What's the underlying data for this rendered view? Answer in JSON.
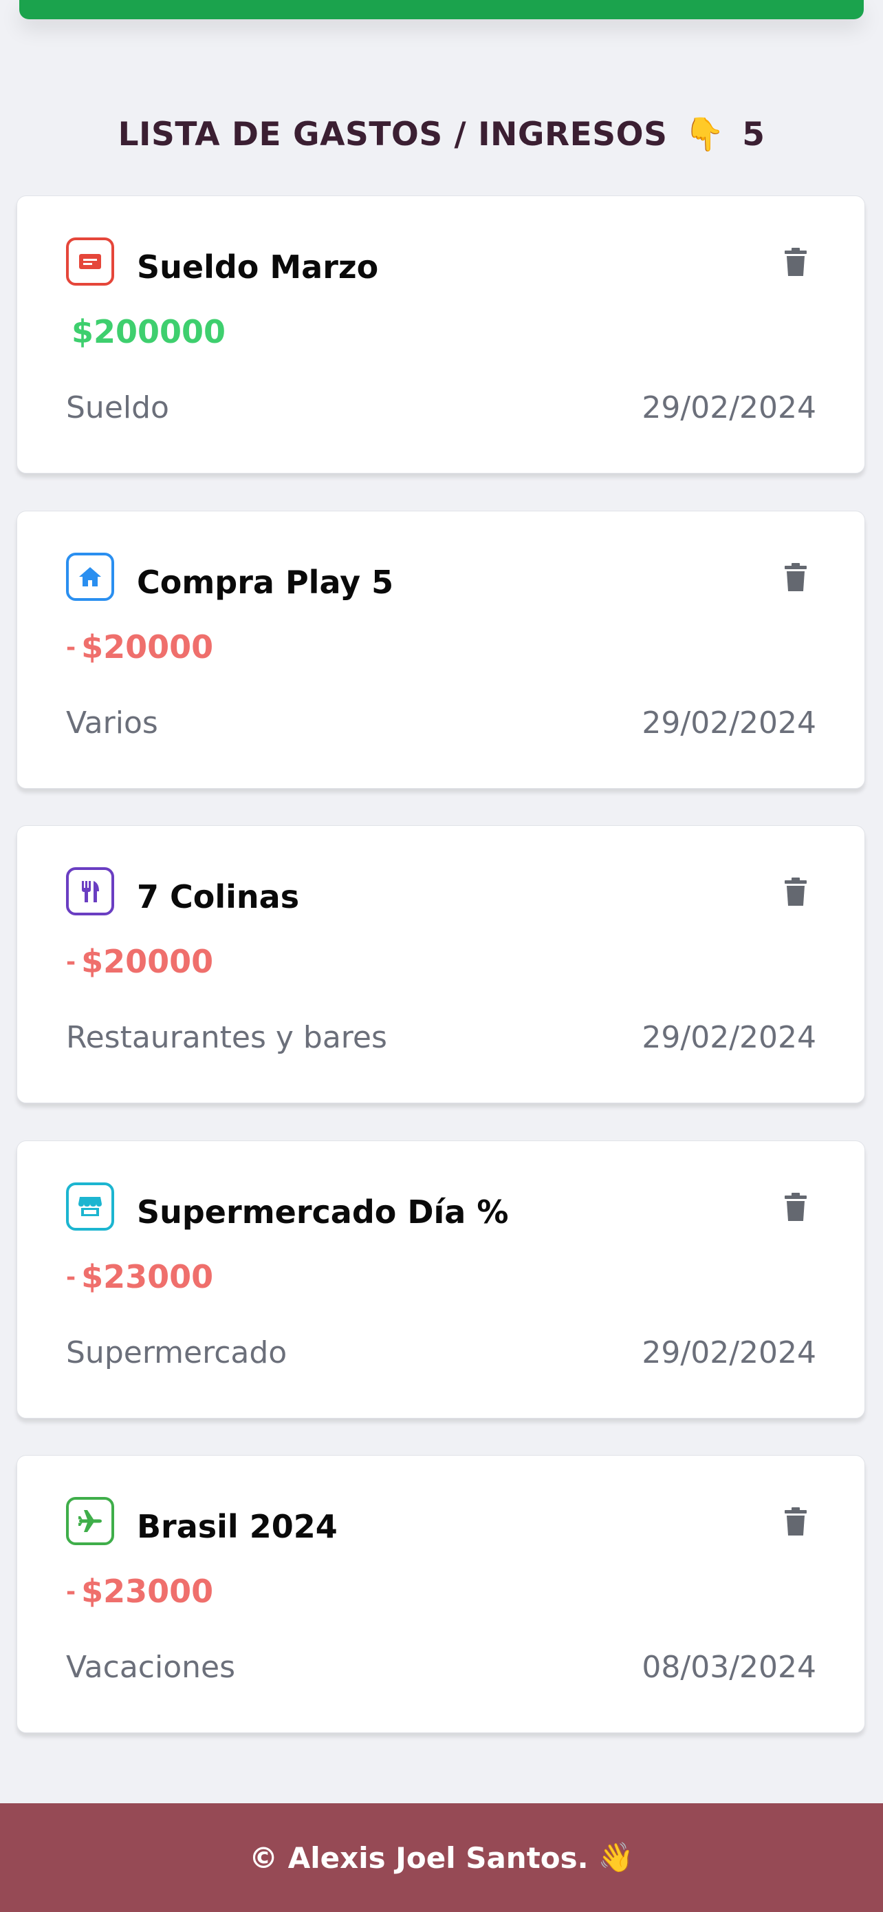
{
  "header": {
    "title": "LISTA DE GASTOS / INGRESOS",
    "hand_emoji": "👇",
    "count": "5"
  },
  "items": [
    {
      "name": "Sueldo Marzo",
      "amount_sign": "",
      "amount": "$200000",
      "type": "income",
      "category": "Sueldo",
      "date": "29/02/2024",
      "icon": "id-card-icon",
      "icon_color": "#e5463a"
    },
    {
      "name": "Compra Play 5",
      "amount_sign": "-",
      "amount": "$20000",
      "type": "expense",
      "category": "Varios",
      "date": "29/02/2024",
      "icon": "home-icon",
      "icon_color": "#2a8ff0"
    },
    {
      "name": "7 Colinas",
      "amount_sign": "-",
      "amount": "$20000",
      "type": "expense",
      "category": "Restaurantes y bares",
      "date": "29/02/2024",
      "icon": "utensils-icon",
      "icon_color": "#6a3ec2"
    },
    {
      "name": "Supermercado Día %",
      "amount_sign": "-",
      "amount": "$23000",
      "type": "expense",
      "category": "Supermercado",
      "date": "29/02/2024",
      "icon": "store-icon",
      "icon_color": "#1cb5d0"
    },
    {
      "name": "Brasil 2024",
      "amount_sign": "-",
      "amount": "$23000",
      "type": "expense",
      "category": "Vacaciones",
      "date": "08/03/2024",
      "icon": "plane-icon",
      "icon_color": "#3fae4a"
    }
  ],
  "colors": {
    "income": "#3ecf6e",
    "expense": "#ef6f6c",
    "accent_bar": "#1ba34d",
    "footer": "#964a55"
  },
  "footer": {
    "text": "© Alexis Joel Santos.",
    "emoji": "👋"
  }
}
